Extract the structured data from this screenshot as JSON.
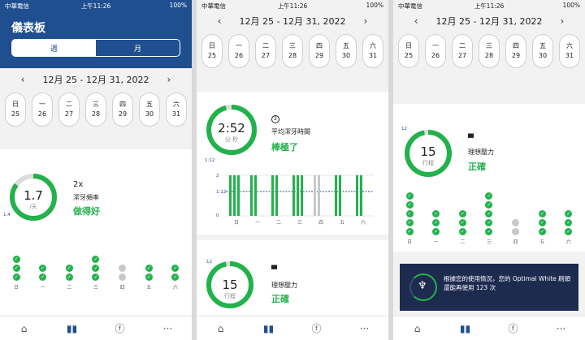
{
  "status": {
    "carrier": "中華電信",
    "time": "上午11:26",
    "battery": "100%"
  },
  "dashboard": {
    "title": "儀表板",
    "tab_week": "週",
    "tab_month": "月"
  },
  "range": {
    "label": "12月 25 - 12月 31, 2022",
    "prev": "‹",
    "next": "›"
  },
  "days": [
    {
      "w": "日",
      "d": "25"
    },
    {
      "w": "一",
      "d": "26"
    },
    {
      "w": "二",
      "d": "27"
    },
    {
      "w": "三",
      "d": "28"
    },
    {
      "w": "四",
      "d": "29"
    },
    {
      "w": "五",
      "d": "30"
    },
    {
      "w": "六",
      "d": "31"
    }
  ],
  "frequency": {
    "value": "1.7",
    "unit": "/天",
    "count": "2x",
    "label": "潔牙頻率",
    "verdict": "做得好",
    "tick": "1.4",
    "fill": 0.85
  },
  "frequency_checks": [
    3,
    2,
    2,
    3,
    0,
    2,
    2
  ],
  "duration": {
    "value": "2:52",
    "unit": "分 秒",
    "icon_num": "2",
    "label": "平均潔牙時間",
    "verdict": "棒極了",
    "tick": "1:12",
    "fill": 0.96
  },
  "duration_chart": {
    "y_labels": [
      "2",
      "1:12",
      "0"
    ],
    "day_labels": [
      "日",
      "一",
      "二",
      "三",
      "四",
      "五",
      "六"
    ]
  },
  "pressure": {
    "value": "15",
    "unit": "行程",
    "label": "理想壓力",
    "verdict": "正確",
    "tick": "12",
    "fill": 0.97
  },
  "pressure_checks": [
    5,
    3,
    3,
    5,
    2,
    3,
    3
  ],
  "promo": {
    "text": "根據您的使用情況，您的 Optimal White 刷頭還能再使用 123 次"
  },
  "nav": [
    "home-icon",
    "chart-icon",
    "brushhead-icon",
    "more-icon"
  ],
  "colors": {
    "brand": "#1f4f8f",
    "green": "#22b24c",
    "grey": "#c8c8c8",
    "promo": "#1d2b4f"
  }
}
